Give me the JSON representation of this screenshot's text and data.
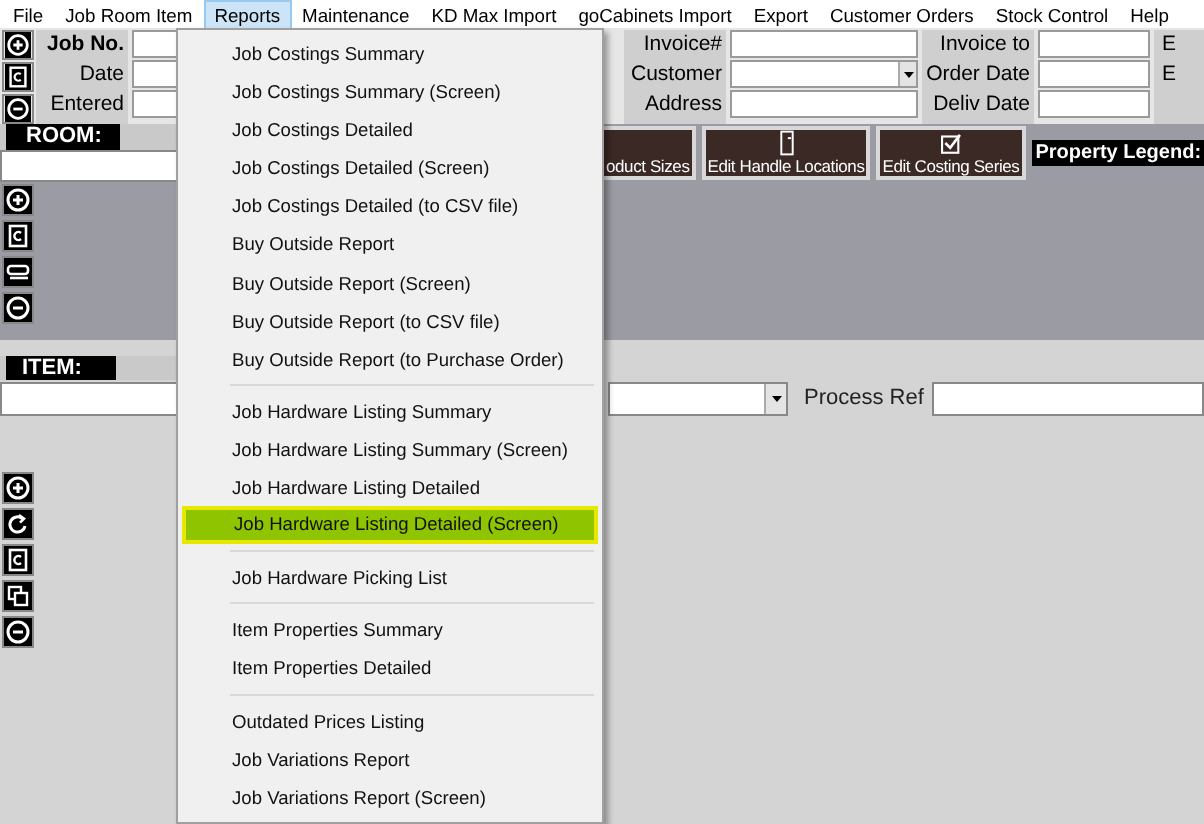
{
  "menu_bar": [
    {
      "label": "File",
      "selected": false
    },
    {
      "label": "Job Room Item",
      "selected": false
    },
    {
      "label": "Reports",
      "selected": true
    },
    {
      "label": "Maintenance",
      "selected": false
    },
    {
      "label": "KD Max Import",
      "selected": false
    },
    {
      "label": "goCabinets Import",
      "selected": false
    },
    {
      "label": "Export",
      "selected": false
    },
    {
      "label": "Customer Orders",
      "selected": false
    },
    {
      "label": "Stock Control",
      "selected": false
    },
    {
      "label": "Help",
      "selected": false
    }
  ],
  "job_fields": [
    {
      "label": "Job No.",
      "bold": true
    },
    {
      "label": "Date",
      "bold": false
    },
    {
      "label": "Entered",
      "bold": false
    }
  ],
  "invoice_fields": [
    {
      "label": "Invoice#",
      "kind": "text"
    },
    {
      "label": "Customer",
      "kind": "dropdown"
    },
    {
      "label": "Address",
      "kind": "text"
    }
  ],
  "date_fields": [
    {
      "label": "Invoice to"
    },
    {
      "label": "Order Date"
    },
    {
      "label": "Deliv Date"
    }
  ],
  "column_4_labels": [
    "E",
    "E"
  ],
  "room": {
    "label": "ROOM:",
    "buttons": [
      {
        "label": "oduct Sizes"
      },
      {
        "label": "Edit Handle Locations"
      },
      {
        "label": "Edit Costing Series"
      }
    ],
    "legend": "Property Legend:"
  },
  "item": {
    "label": "ITEM:",
    "fields": [
      {
        "kind": "dropdown"
      },
      {
        "kind": "text",
        "label": "Process Ref"
      }
    ]
  },
  "reports_menu": {
    "groups": [
      {
        "items": [
          {
            "label": "Job Costings Summary",
            "selected": false
          },
          {
            "label": "Job Costings Summary (Screen)",
            "selected": false
          },
          {
            "label": "Job Costings Detailed",
            "selected": false
          },
          {
            "label": "Job Costings Detailed (Screen)",
            "selected": false
          },
          {
            "label": "Job Costings Detailed (to CSV file)",
            "selected": false
          },
          {
            "label": "Buy Outside Report",
            "selected": false
          },
          {
            "label": "Buy Outside Report (Screen)",
            "selected": false
          },
          {
            "label": "Buy Outside Report (to CSV file)",
            "selected": false
          },
          {
            "label": "Buy Outside Report (to Purchase Order)",
            "selected": false
          }
        ]
      },
      {
        "items": [
          {
            "label": "Job Hardware Listing Summary",
            "selected": false
          },
          {
            "label": "Job Hardware Listing Summary (Screen)",
            "selected": false
          },
          {
            "label": "Job Hardware Listing Detailed",
            "selected": false
          },
          {
            "label": "Job Hardware Listing Detailed (Screen)",
            "selected": true
          }
        ]
      },
      {
        "items": [
          {
            "label": "Job Hardware Picking List",
            "selected": false
          }
        ]
      },
      {
        "items": [
          {
            "label": "Item Properties Summary",
            "selected": false
          },
          {
            "label": "Item Properties Detailed",
            "selected": false
          }
        ]
      },
      {
        "items": [
          {
            "label": "Outdated Prices Listing",
            "selected": false
          },
          {
            "label": "Job Variations Report",
            "selected": false
          },
          {
            "label": "Job Variations Report (Screen)",
            "selected": false
          }
        ]
      }
    ]
  }
}
